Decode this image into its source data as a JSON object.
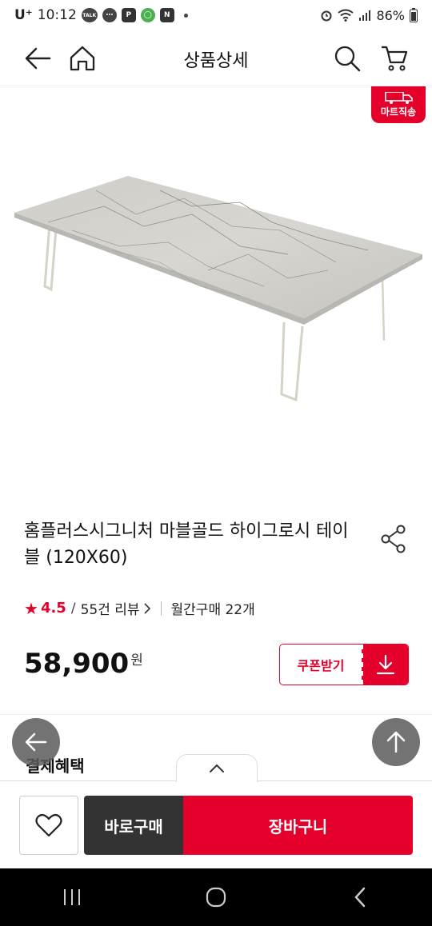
{
  "status_bar": {
    "carrier": "U⁺",
    "time": "10:12",
    "notif_talk": "TALK",
    "notif_p": "P",
    "notif_n": "N",
    "battery": "86%"
  },
  "header": {
    "title": "상품상세"
  },
  "product": {
    "badge": "마트직송",
    "title": "홈플러스시그니처 마블골드 하이그로시 테이블 (120X60)",
    "rating": "4.5",
    "review_count": "55건 리뷰",
    "monthly_purchases": "월간구매 22개",
    "price": "58,900",
    "currency": "원"
  },
  "coupon": {
    "label": "쿠폰받기"
  },
  "sections": {
    "payment_benefits": "결제혜택"
  },
  "bottom_bar": {
    "buy_now": "바로구매",
    "add_to_cart": "장바구니"
  },
  "colors": {
    "accent": "#e5002b",
    "dark_button": "#333333"
  }
}
